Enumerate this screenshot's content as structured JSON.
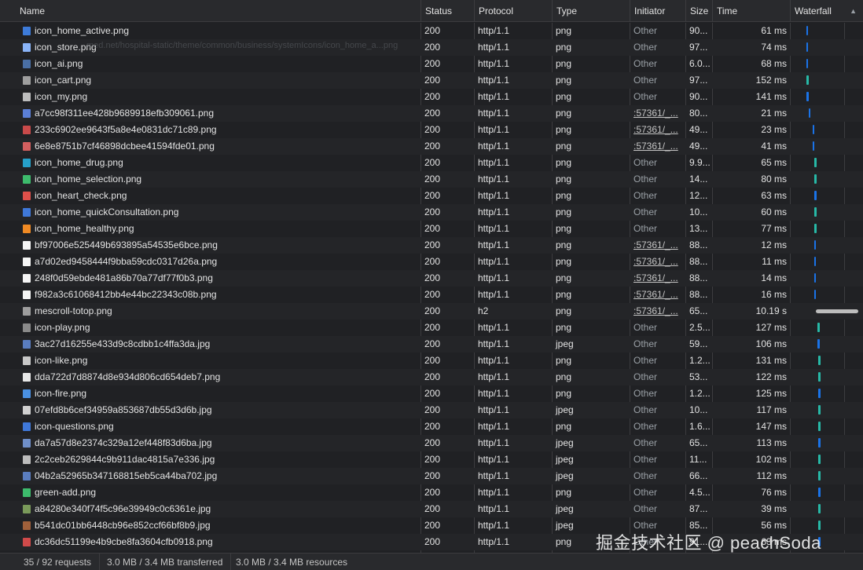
{
  "columns": {
    "name": "Name",
    "status": "Status",
    "protocol": "Protocol",
    "type": "Type",
    "initiator": "Initiator",
    "size": "Size",
    "time": "Time",
    "waterfall": "Waterfall"
  },
  "tooltip_ghost": "med.net/hospital-static/theme/common/business/systemIcons/icon_home_a...png",
  "rows": [
    {
      "name": "icon_home_active.png",
      "status": "200",
      "protocol": "http/1.1",
      "type": "png",
      "initiator": "Other",
      "size": "90...",
      "time": "61 ms",
      "link": false,
      "icon": "#3d7bd9"
    },
    {
      "name": "icon_store.png",
      "status": "200",
      "protocol": "http/1.1",
      "type": "png",
      "initiator": "Other",
      "size": "97...",
      "time": "74 ms",
      "link": false,
      "icon": "#8ab4f8"
    },
    {
      "name": "icon_ai.png",
      "status": "200",
      "protocol": "http/1.1",
      "type": "png",
      "initiator": "Other",
      "size": "6.0...",
      "time": "68 ms",
      "link": false,
      "icon": "#4a6fa5"
    },
    {
      "name": "icon_cart.png",
      "status": "200",
      "protocol": "http/1.1",
      "type": "png",
      "initiator": "Other",
      "size": "97...",
      "time": "152 ms",
      "link": false,
      "icon": "#9e9e9e"
    },
    {
      "name": "icon_my.png",
      "status": "200",
      "protocol": "http/1.1",
      "type": "png",
      "initiator": "Other",
      "size": "90...",
      "time": "141 ms",
      "link": false,
      "icon": "#bdbdbd"
    },
    {
      "name": "a7cc98f311ee428b9689918efb309061.png",
      "status": "200",
      "protocol": "http/1.1",
      "type": "png",
      "initiator": ":57361/_...",
      "size": "80...",
      "time": "21 ms",
      "link": true,
      "icon": "#5b7fd6"
    },
    {
      "name": "233c6902ee9643f5a8e4e0831dc71c89.png",
      "status": "200",
      "protocol": "http/1.1",
      "type": "png",
      "initiator": ":57361/_...",
      "size": "49...",
      "time": "23 ms",
      "link": true,
      "icon": "#c94a4a"
    },
    {
      "name": "6e8e8751b7cf46898dcbee41594fde01.png",
      "status": "200",
      "protocol": "http/1.1",
      "type": "png",
      "initiator": ":57361/_...",
      "size": "49...",
      "time": "41 ms",
      "link": true,
      "icon": "#d45f5f"
    },
    {
      "name": "icon_home_drug.png",
      "status": "200",
      "protocol": "http/1.1",
      "type": "png",
      "initiator": "Other",
      "size": "9.9...",
      "time": "65 ms",
      "link": false,
      "icon": "#26a0c9"
    },
    {
      "name": "icon_home_selection.png",
      "status": "200",
      "protocol": "http/1.1",
      "type": "png",
      "initiator": "Other",
      "size": "14...",
      "time": "80 ms",
      "link": false,
      "icon": "#3dbb6c"
    },
    {
      "name": "icon_heart_check.png",
      "status": "200",
      "protocol": "http/1.1",
      "type": "png",
      "initiator": "Other",
      "size": "12...",
      "time": "63 ms",
      "link": false,
      "icon": "#e0504a"
    },
    {
      "name": "icon_home_quickConsultation.png",
      "status": "200",
      "protocol": "http/1.1",
      "type": "png",
      "initiator": "Other",
      "size": "10...",
      "time": "60 ms",
      "link": false,
      "icon": "#3f78d9"
    },
    {
      "name": "icon_home_healthy.png",
      "status": "200",
      "protocol": "http/1.1",
      "type": "png",
      "initiator": "Other",
      "size": "13...",
      "time": "77 ms",
      "link": false,
      "icon": "#f08a24"
    },
    {
      "name": "bf97006e525449b693895a54535e6bce.png",
      "status": "200",
      "protocol": "http/1.1",
      "type": "png",
      "initiator": ":57361/_...",
      "size": "88...",
      "time": "12 ms",
      "link": true,
      "icon": "#f5f5f5"
    },
    {
      "name": "a7d02ed9458444f9bba59cdc0317d26a.png",
      "status": "200",
      "protocol": "http/1.1",
      "type": "png",
      "initiator": ":57361/_...",
      "size": "88...",
      "time": "11 ms",
      "link": true,
      "icon": "#f5f5f5"
    },
    {
      "name": "248f0d59ebde481a86b70a77df77f0b3.png",
      "status": "200",
      "protocol": "http/1.1",
      "type": "png",
      "initiator": ":57361/_...",
      "size": "88...",
      "time": "14 ms",
      "link": true,
      "icon": "#f5f5f5"
    },
    {
      "name": "f982a3c61068412bb4e44bc22343c08b.png",
      "status": "200",
      "protocol": "http/1.1",
      "type": "png",
      "initiator": ":57361/_...",
      "size": "88...",
      "time": "16 ms",
      "link": true,
      "icon": "#f5f5f5"
    },
    {
      "name": "mescroll-totop.png",
      "status": "200",
      "protocol": "h2",
      "type": "png",
      "initiator": ":57361/_...",
      "size": "65...",
      "time": "10.19 s",
      "link": true,
      "icon": "#9e9e9e"
    },
    {
      "name": "icon-play.png",
      "status": "200",
      "protocol": "http/1.1",
      "type": "png",
      "initiator": "Other",
      "size": "2.5...",
      "time": "127 ms",
      "link": false,
      "icon": "#8a8a8a"
    },
    {
      "name": "3ac27d16255e433d9c8cdbb1c4ffa3da.jpg",
      "status": "200",
      "protocol": "http/1.1",
      "type": "jpeg",
      "initiator": "Other",
      "size": "59...",
      "time": "106 ms",
      "link": false,
      "icon": "#5a7dbf"
    },
    {
      "name": "icon-like.png",
      "status": "200",
      "protocol": "http/1.1",
      "type": "png",
      "initiator": "Other",
      "size": "1.2...",
      "time": "131 ms",
      "link": false,
      "icon": "#c8c8c8"
    },
    {
      "name": "dda722d7d8874d8e934d806cd654deb7.png",
      "status": "200",
      "protocol": "http/1.1",
      "type": "png",
      "initiator": "Other",
      "size": "53...",
      "time": "122 ms",
      "link": false,
      "icon": "#e8e8e8"
    },
    {
      "name": "icon-fire.png",
      "status": "200",
      "protocol": "http/1.1",
      "type": "png",
      "initiator": "Other",
      "size": "1.2...",
      "time": "125 ms",
      "link": false,
      "icon": "#4a90e2"
    },
    {
      "name": "07efd8b6cef34959a853687db55d3d6b.jpg",
      "status": "200",
      "protocol": "http/1.1",
      "type": "jpeg",
      "initiator": "Other",
      "size": "10...",
      "time": "117 ms",
      "link": false,
      "icon": "#d0d0d0"
    },
    {
      "name": "icon-questions.png",
      "status": "200",
      "protocol": "http/1.1",
      "type": "png",
      "initiator": "Other",
      "size": "1.6...",
      "time": "147 ms",
      "link": false,
      "icon": "#3f78d9"
    },
    {
      "name": "da7a57d8e2374c329a12ef448f83d6ba.jpg",
      "status": "200",
      "protocol": "http/1.1",
      "type": "jpeg",
      "initiator": "Other",
      "size": "65...",
      "time": "113 ms",
      "link": false,
      "icon": "#6f8fc9"
    },
    {
      "name": "2c2ceb2629844c9b911dac4815a7e336.jpg",
      "status": "200",
      "protocol": "http/1.1",
      "type": "jpeg",
      "initiator": "Other",
      "size": "11...",
      "time": "102 ms",
      "link": false,
      "icon": "#bdbdbd"
    },
    {
      "name": "04b2a52965b347168815eb5ca44ba702.jpg",
      "status": "200",
      "protocol": "http/1.1",
      "type": "jpeg",
      "initiator": "Other",
      "size": "66...",
      "time": "112 ms",
      "link": false,
      "icon": "#5a7dbf"
    },
    {
      "name": "green-add.png",
      "status": "200",
      "protocol": "http/1.1",
      "type": "png",
      "initiator": "Other",
      "size": "4.5...",
      "time": "76 ms",
      "link": false,
      "icon": "#3dbb6c"
    },
    {
      "name": "a84280e340f74f5c96e39949c0c6361e.jpg",
      "status": "200",
      "protocol": "http/1.1",
      "type": "jpeg",
      "initiator": "Other",
      "size": "87...",
      "time": "39 ms",
      "link": false,
      "icon": "#7a9a5a"
    },
    {
      "name": "b541dc01bb6448cb96e852ccf66bf8b9.jpg",
      "status": "200",
      "protocol": "http/1.1",
      "type": "jpeg",
      "initiator": "Other",
      "size": "85...",
      "time": "56 ms",
      "link": false,
      "icon": "#a0603a"
    },
    {
      "name": "dc36dc51199e4b9cbe8fa3604cfb0918.png",
      "status": "200",
      "protocol": "http/1.1",
      "type": "png",
      "initiator": "Other",
      "size": "91...",
      "time": "63 ms",
      "link": false,
      "icon": "#d04a4a"
    }
  ],
  "waterfall_colors": {
    "blue": "#1a73e8",
    "teal": "#27b9a7",
    "gray": "#bdbdbd"
  },
  "status_bar": {
    "requests": "35 / 92 requests",
    "transferred": "3.0 MB / 3.4 MB transferred",
    "resources": "3.0 MB / 3.4 MB resources"
  },
  "watermark": "掘金技术社区 @ peachSoda"
}
